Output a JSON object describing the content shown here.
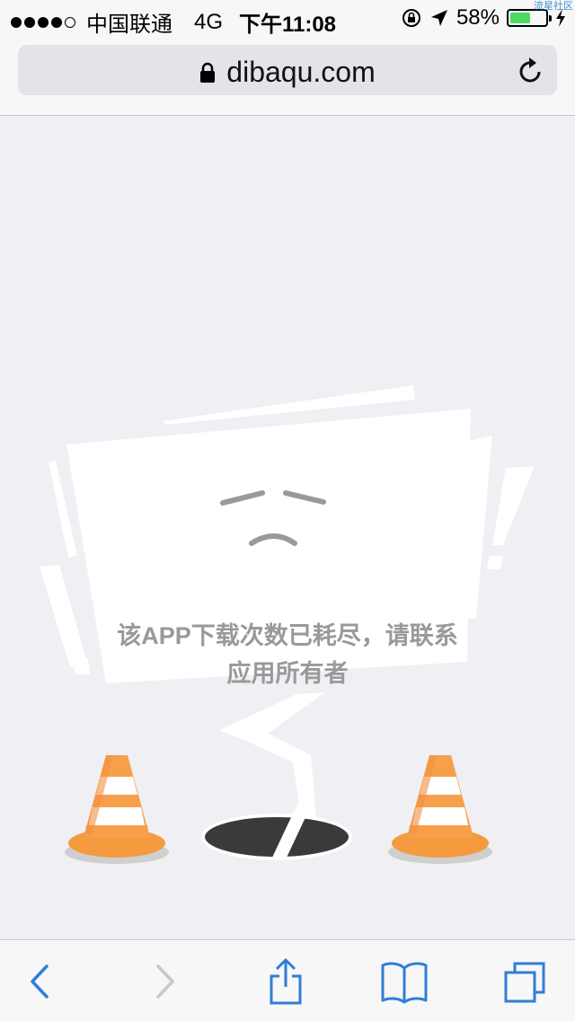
{
  "status_bar": {
    "carrier": "中国联通",
    "network": "4G",
    "time": "下午11:08",
    "battery_percent": "58%",
    "battery_level": 0.58,
    "watermark": "流星社区"
  },
  "address_bar": {
    "url": "dibaqu.com"
  },
  "page": {
    "message": "该APP下载次数已耗尽，请联系应用所有者"
  },
  "toolbar": {
    "icons": [
      "back-icon",
      "forward-icon",
      "share-icon",
      "bookmarks-icon",
      "tabs-icon"
    ]
  },
  "colors": {
    "accent": "#2f7ed8",
    "background": "#efeff4",
    "cone_orange": "#f7a04b"
  }
}
